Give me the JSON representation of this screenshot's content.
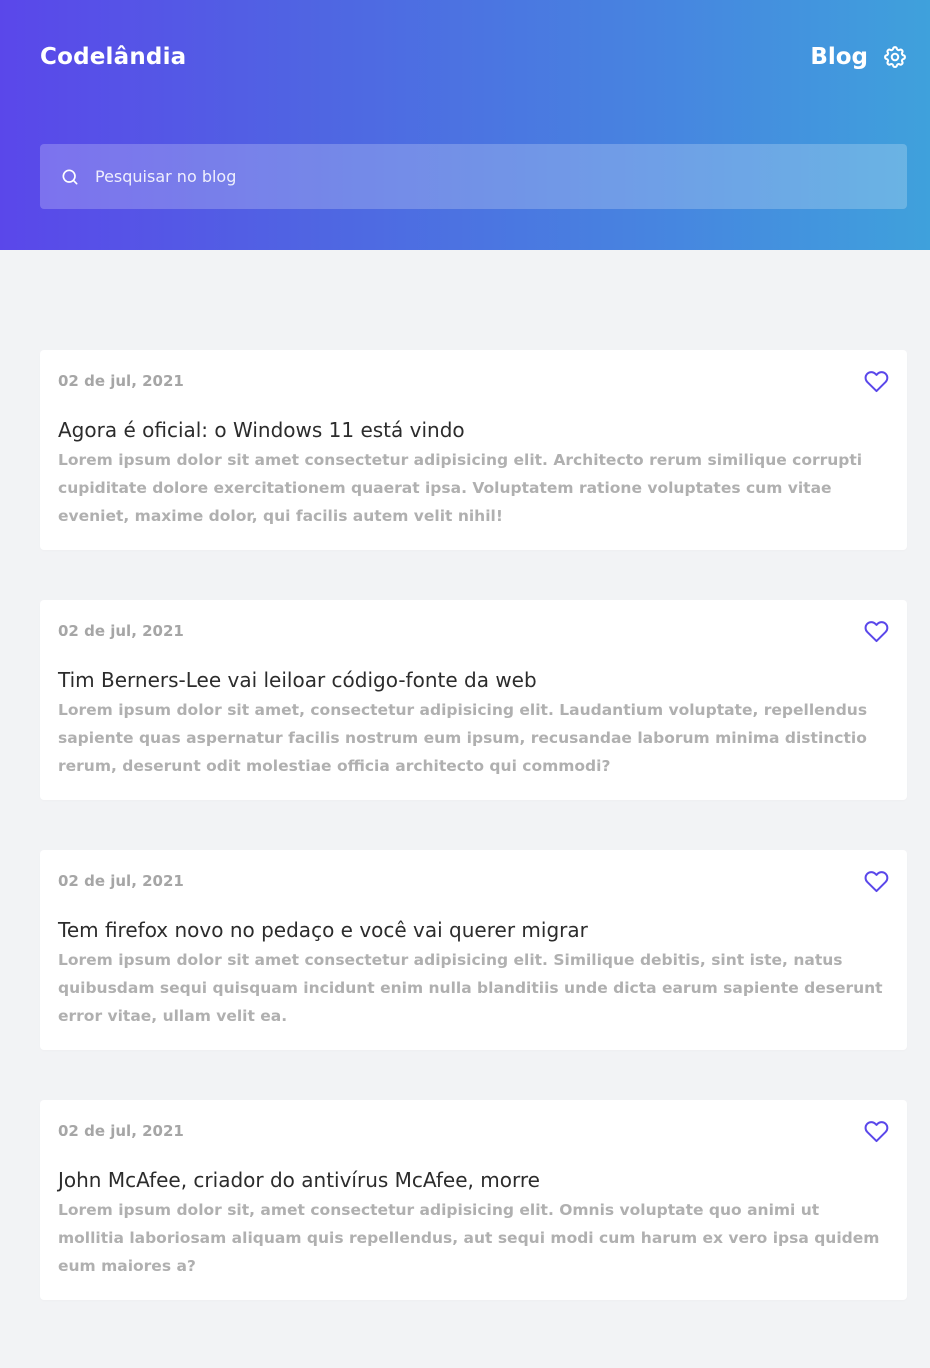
{
  "header": {
    "brand": "Codelândia",
    "blog_label": "Blog",
    "settings_icon": "gear-icon",
    "gradient": [
      "#5a47ea",
      "#3fa1dc"
    ]
  },
  "search": {
    "placeholder": "Pesquisar no blog",
    "value": "",
    "icon": "search-icon"
  },
  "accent_color": "#5a47ea",
  "posts": [
    {
      "date": "02 de jul, 2021",
      "title": "Agora é oficial: o Windows 11 está vindo",
      "text": "Lorem ipsum dolor sit amet consectetur adipisicing elit. Architecto rerum similique corrupti cupiditate dolore exercitationem quaerat ipsa. Voluptatem ratione voluptates cum vitae eveniet, maxime dolor, qui facilis autem velit nihil!",
      "icon": "heart-icon"
    },
    {
      "date": "02 de jul, 2021",
      "title": "Tim Berners-Lee vai leiloar código-fonte da web",
      "text": "Lorem ipsum dolor sit amet, consectetur adipisicing elit. Laudantium voluptate, repellendus sapiente quas aspernatur facilis nostrum eum ipsum, recusandae laborum minima distinctio rerum, deserunt odit molestiae officia architecto qui commodi?",
      "icon": "heart-icon"
    },
    {
      "date": "02 de jul, 2021",
      "title": "Tem firefox novo no pedaço e você vai querer migrar",
      "text": "Lorem ipsum dolor sit amet consectetur adipisicing elit. Similique debitis, sint iste, natus quibusdam sequi quisquam incidunt enim nulla blanditiis unde dicta earum sapiente deserunt error vitae, ullam velit ea.",
      "icon": "heart-icon"
    },
    {
      "date": "02 de jul, 2021",
      "title": "John McAfee, criador do antivírus McAfee, morre",
      "text": "Lorem ipsum dolor sit, amet consectetur adipisicing elit. Omnis voluptate quo animi ut mollitia laboriosam aliquam quis repellendus, aut sequi modi cum harum ex vero ipsa quidem eum maiores a?",
      "icon": "heart-icon"
    }
  ]
}
